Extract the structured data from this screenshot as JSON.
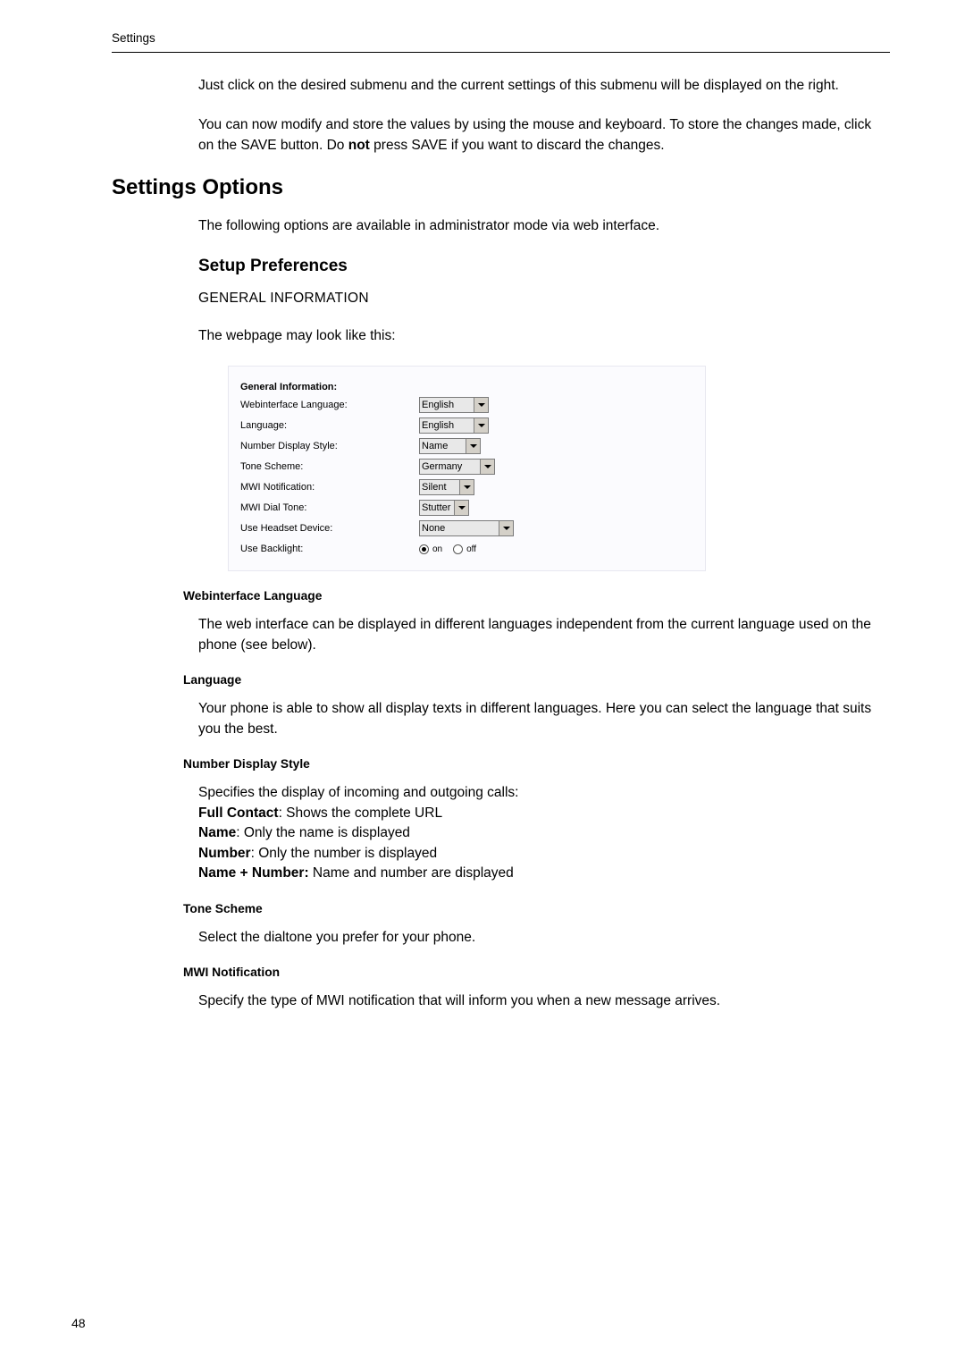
{
  "header": "Settings",
  "intro1": "Just click on the desired submenu and the current settings of this submenu will be displayed on the right.",
  "intro2a": "You can now modify and store the values by using the mouse and keyboard.  To store the changes made,  click on the SAVE button.  Do ",
  "intro2b": "not",
  "intro2c": " press SAVE if you want to discard the changes.",
  "h1": "Settings Options",
  "h1_para": "The following options are available in administrator mode via web interface.",
  "h2": "Setup Preferences",
  "h3": "GENERAL INFORMATION",
  "h3_para": "The webpage may look like this:",
  "form": {
    "title": "General Information:",
    "rows": [
      {
        "label": "Webinterface Language:",
        "value": "English",
        "type": "select",
        "w": "w1"
      },
      {
        "label": "Language:",
        "value": "English",
        "type": "select",
        "w": "w2"
      },
      {
        "label": "Number Display Style:",
        "value": "Name",
        "type": "select",
        "w": "w3"
      },
      {
        "label": "Tone Scheme:",
        "value": "Germany",
        "type": "select",
        "w": "w4"
      },
      {
        "label": "MWI Notification:",
        "value": "Silent",
        "type": "select",
        "w": "w5"
      },
      {
        "label": "MWI Dial Tone:",
        "value": "Stutter",
        "type": "select",
        "w": "w6"
      },
      {
        "label": "Use Headset Device:",
        "value": "None",
        "type": "select",
        "w": "w7"
      }
    ],
    "backlight": {
      "label": "Use Backlight:",
      "opt1": "on",
      "opt2": "off"
    }
  },
  "sections": [
    {
      "title": "Webinterface Language",
      "body": "The web interface can be displayed in different languages independent from the current language used on the phone (see below)."
    },
    {
      "title": "Language",
      "body": "Your phone is able to show all display texts in different languages.  Here you can select the language that suits you the best."
    },
    {
      "title": "Number Display Style",
      "lines": [
        {
          "plain": "Specifies the display of incoming and outgoing calls:"
        },
        {
          "bold": "Full Contact",
          "rest": ": Shows the complete URL"
        },
        {
          "bold": "Name",
          "rest": ": Only the name is displayed"
        },
        {
          "bold": "Number",
          "rest": ": Only the number is displayed"
        },
        {
          "bold": "Name + Number:",
          "rest": " Name and number are displayed"
        }
      ]
    },
    {
      "title": "Tone Scheme",
      "body": "Select the dialtone you prefer for your phone."
    },
    {
      "title": "MWI Notification",
      "body": "Specify the type of MWI notification that will inform you when a new message arrives."
    }
  ],
  "page_number": "48"
}
